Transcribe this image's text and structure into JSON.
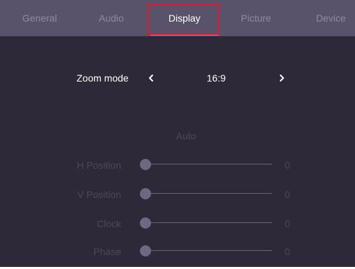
{
  "tabs": [
    {
      "label": "General",
      "active": false
    },
    {
      "label": "Audio",
      "active": false
    },
    {
      "label": "Display",
      "active": true
    },
    {
      "label": "Picture",
      "active": false
    },
    {
      "label": "Device",
      "active": false
    }
  ],
  "zoom_mode": {
    "label": "Zoom mode",
    "value": "16:9",
    "prev_icon": "chevron-left-icon",
    "next_icon": "chevron-right-icon"
  },
  "auto_label": "Auto",
  "sliders": [
    {
      "label": "H Position",
      "value": "0",
      "level": 0
    },
    {
      "label": "V Position",
      "value": "0",
      "level": 0
    },
    {
      "label": "Clock",
      "value": "0",
      "level": 0
    },
    {
      "label": "Phase",
      "value": "0",
      "level": 0
    }
  ],
  "colors": {
    "background": "#2e2938",
    "tab_bar": "#58536b",
    "active_tab_text": "#ffffff",
    "inactive_tab_text": "#8f8aa0",
    "active_underline": "#8c86e6",
    "highlight_box": "#e11b22",
    "disabled_text": "#4d475c"
  }
}
